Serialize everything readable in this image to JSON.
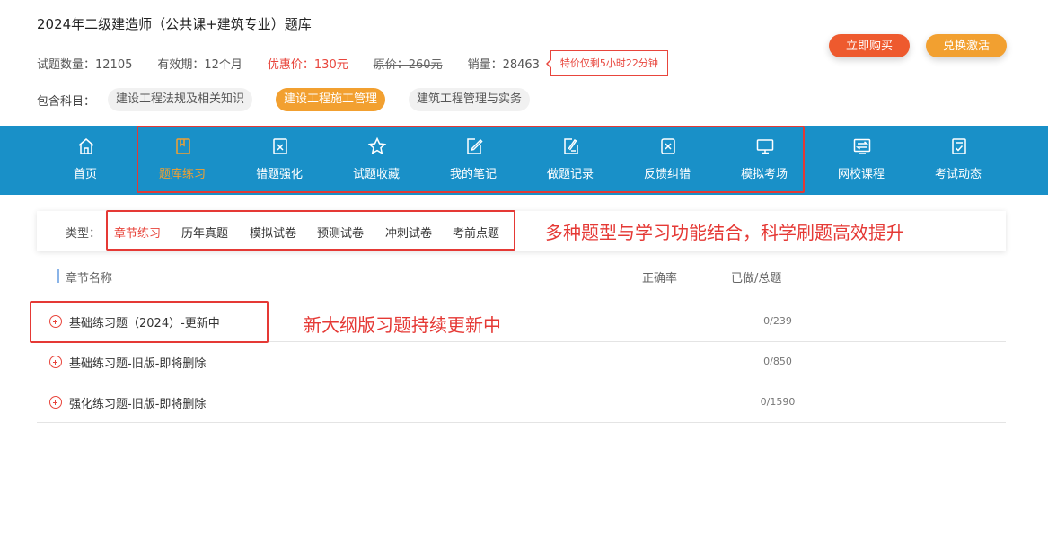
{
  "header": {
    "title": "2024年二级建造师（公共课+建筑专业）题库",
    "question_count": "试题数量：12105",
    "validity": "有效期：12个月",
    "sale_price": "优惠价：130元",
    "original_price": "原价：260元",
    "sales": "销量：28463",
    "countdown": "特价仅剩5小时22分钟",
    "buy_label": "立即购买",
    "redeem_label": "兑换激活"
  },
  "subjects": {
    "label": "包含科目：",
    "items": [
      {
        "label": "建设工程法规及相关知识",
        "active": false
      },
      {
        "label": "建设工程施工管理",
        "active": true
      },
      {
        "label": "建筑工程管理与实务",
        "active": false
      }
    ]
  },
  "nav": {
    "items": [
      {
        "label": "首页",
        "icon": "home-icon"
      },
      {
        "label": "题库练习",
        "icon": "book-icon",
        "active": true
      },
      {
        "label": "错题强化",
        "icon": "wrong-answer-icon"
      },
      {
        "label": "试题收藏",
        "icon": "star-icon"
      },
      {
        "label": "我的笔记",
        "icon": "note-edit-icon"
      },
      {
        "label": "做题记录",
        "icon": "record-icon"
      },
      {
        "label": "反馈纠错",
        "icon": "feedback-icon"
      },
      {
        "label": "模拟考场",
        "icon": "monitor-icon"
      },
      {
        "label": "网校课程",
        "icon": "course-icon"
      },
      {
        "label": "考试动态",
        "icon": "news-check-icon"
      }
    ]
  },
  "types": {
    "label": "类型：",
    "items": [
      "章节练习",
      "历年真题",
      "模拟试卷",
      "预测试卷",
      "冲刺试卷",
      "考前点题"
    ],
    "active_index": 0
  },
  "annotations": {
    "feature_note": "多种题型与学习功能结合，科学刷题高效提升",
    "update_note": "新大纲版习题持续更新中"
  },
  "table": {
    "col_name": "章节名称",
    "col_accuracy": "正确率",
    "col_progress": "已做/总题",
    "rows": [
      {
        "name": "基础练习题（2024）-更新中",
        "progress": "0/239"
      },
      {
        "name": "基础练习题-旧版-即将删除",
        "progress": "0/850"
      },
      {
        "name": "强化练习题-旧版-即将删除",
        "progress": "0/1590"
      }
    ]
  },
  "colors": {
    "nav_bg": "#1990c8",
    "accent_orange": "#f2a030",
    "accent_red": "#e8453c",
    "annotation_red": "#e53935"
  }
}
